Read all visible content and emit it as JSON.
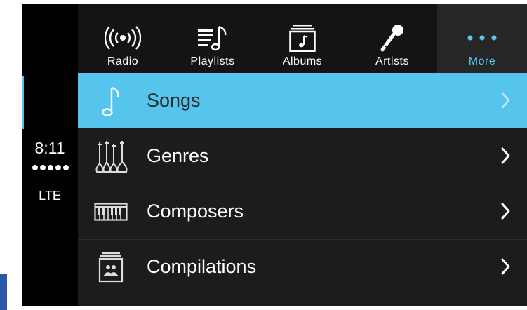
{
  "status": {
    "time": "8:11",
    "signal_bars": 5,
    "network": "LTE"
  },
  "tabs": [
    {
      "label": "Radio",
      "icon": "radio-icon",
      "active": false
    },
    {
      "label": "Playlists",
      "icon": "playlists-icon",
      "active": false
    },
    {
      "label": "Albums",
      "icon": "albums-icon",
      "active": false
    },
    {
      "label": "Artists",
      "icon": "microphone-icon",
      "active": false
    },
    {
      "label": "More",
      "icon": "more-dots-icon",
      "active": true
    }
  ],
  "list": {
    "items": [
      {
        "label": "Songs",
        "icon": "music-note-icon",
        "selected": true
      },
      {
        "label": "Genres",
        "icon": "genres-instruments-icon",
        "selected": false
      },
      {
        "label": "Composers",
        "icon": "piano-icon",
        "selected": false
      },
      {
        "label": "Compilations",
        "icon": "compilations-icon",
        "selected": false
      }
    ]
  },
  "colors": {
    "accent": "#55c5ee",
    "background": "#1c1c1e",
    "tabbar": "#141414",
    "active_tab_bg": "#262626",
    "active_tab_text": "#5cc4ee"
  }
}
